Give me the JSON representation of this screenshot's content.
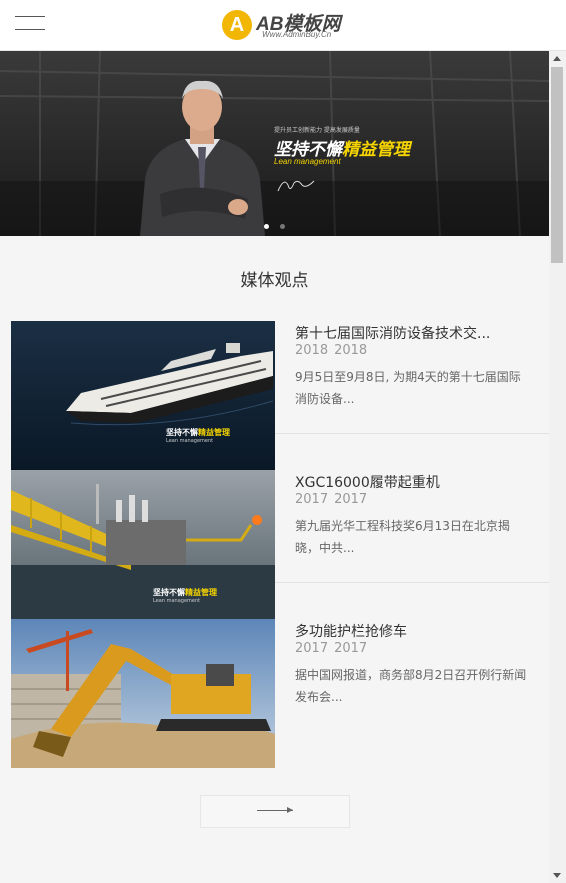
{
  "header": {
    "logo_mark": "A",
    "logo_title": "AB模板网",
    "logo_sub": "Www.AdminBuy.Cn"
  },
  "banner": {
    "small_text": "提升员工创新能力 提高发展质量",
    "headline_white": "坚持不懈",
    "headline_yellow": "精益管理",
    "english": "Lean management",
    "slides": 2,
    "active_slide": 1
  },
  "section": {
    "title": "媒体观点"
  },
  "news": [
    {
      "title": "第十七届国际消防设备技术交...",
      "years": [
        "2018",
        "2018"
      ],
      "desc": "9月5日至9月8日, 为期4天的第十七届国际消防设备...",
      "image": "cruise-ship",
      "caption_white": "坚持不懈",
      "caption_yellow": "精益管理",
      "caption_en": "Lean management"
    },
    {
      "title": "XGC16000履带起重机",
      "years": [
        "2017",
        "2017"
      ],
      "desc": "第九届光华工程科技奖6月13日在北京揭晓，中共...",
      "image": "oil-platform",
      "caption_white": "坚持不懈",
      "caption_yellow": "精益管理",
      "caption_en": "Lean management"
    },
    {
      "title": "多功能护栏抢修车",
      "years": [
        "2017",
        "2017"
      ],
      "desc": "据中国网报道，商务部8月2日召开例行新闻发布会...",
      "image": "excavator"
    }
  ],
  "colors": {
    "accent_yellow": "#f5d400",
    "logo_yellow": "#f2b705"
  }
}
